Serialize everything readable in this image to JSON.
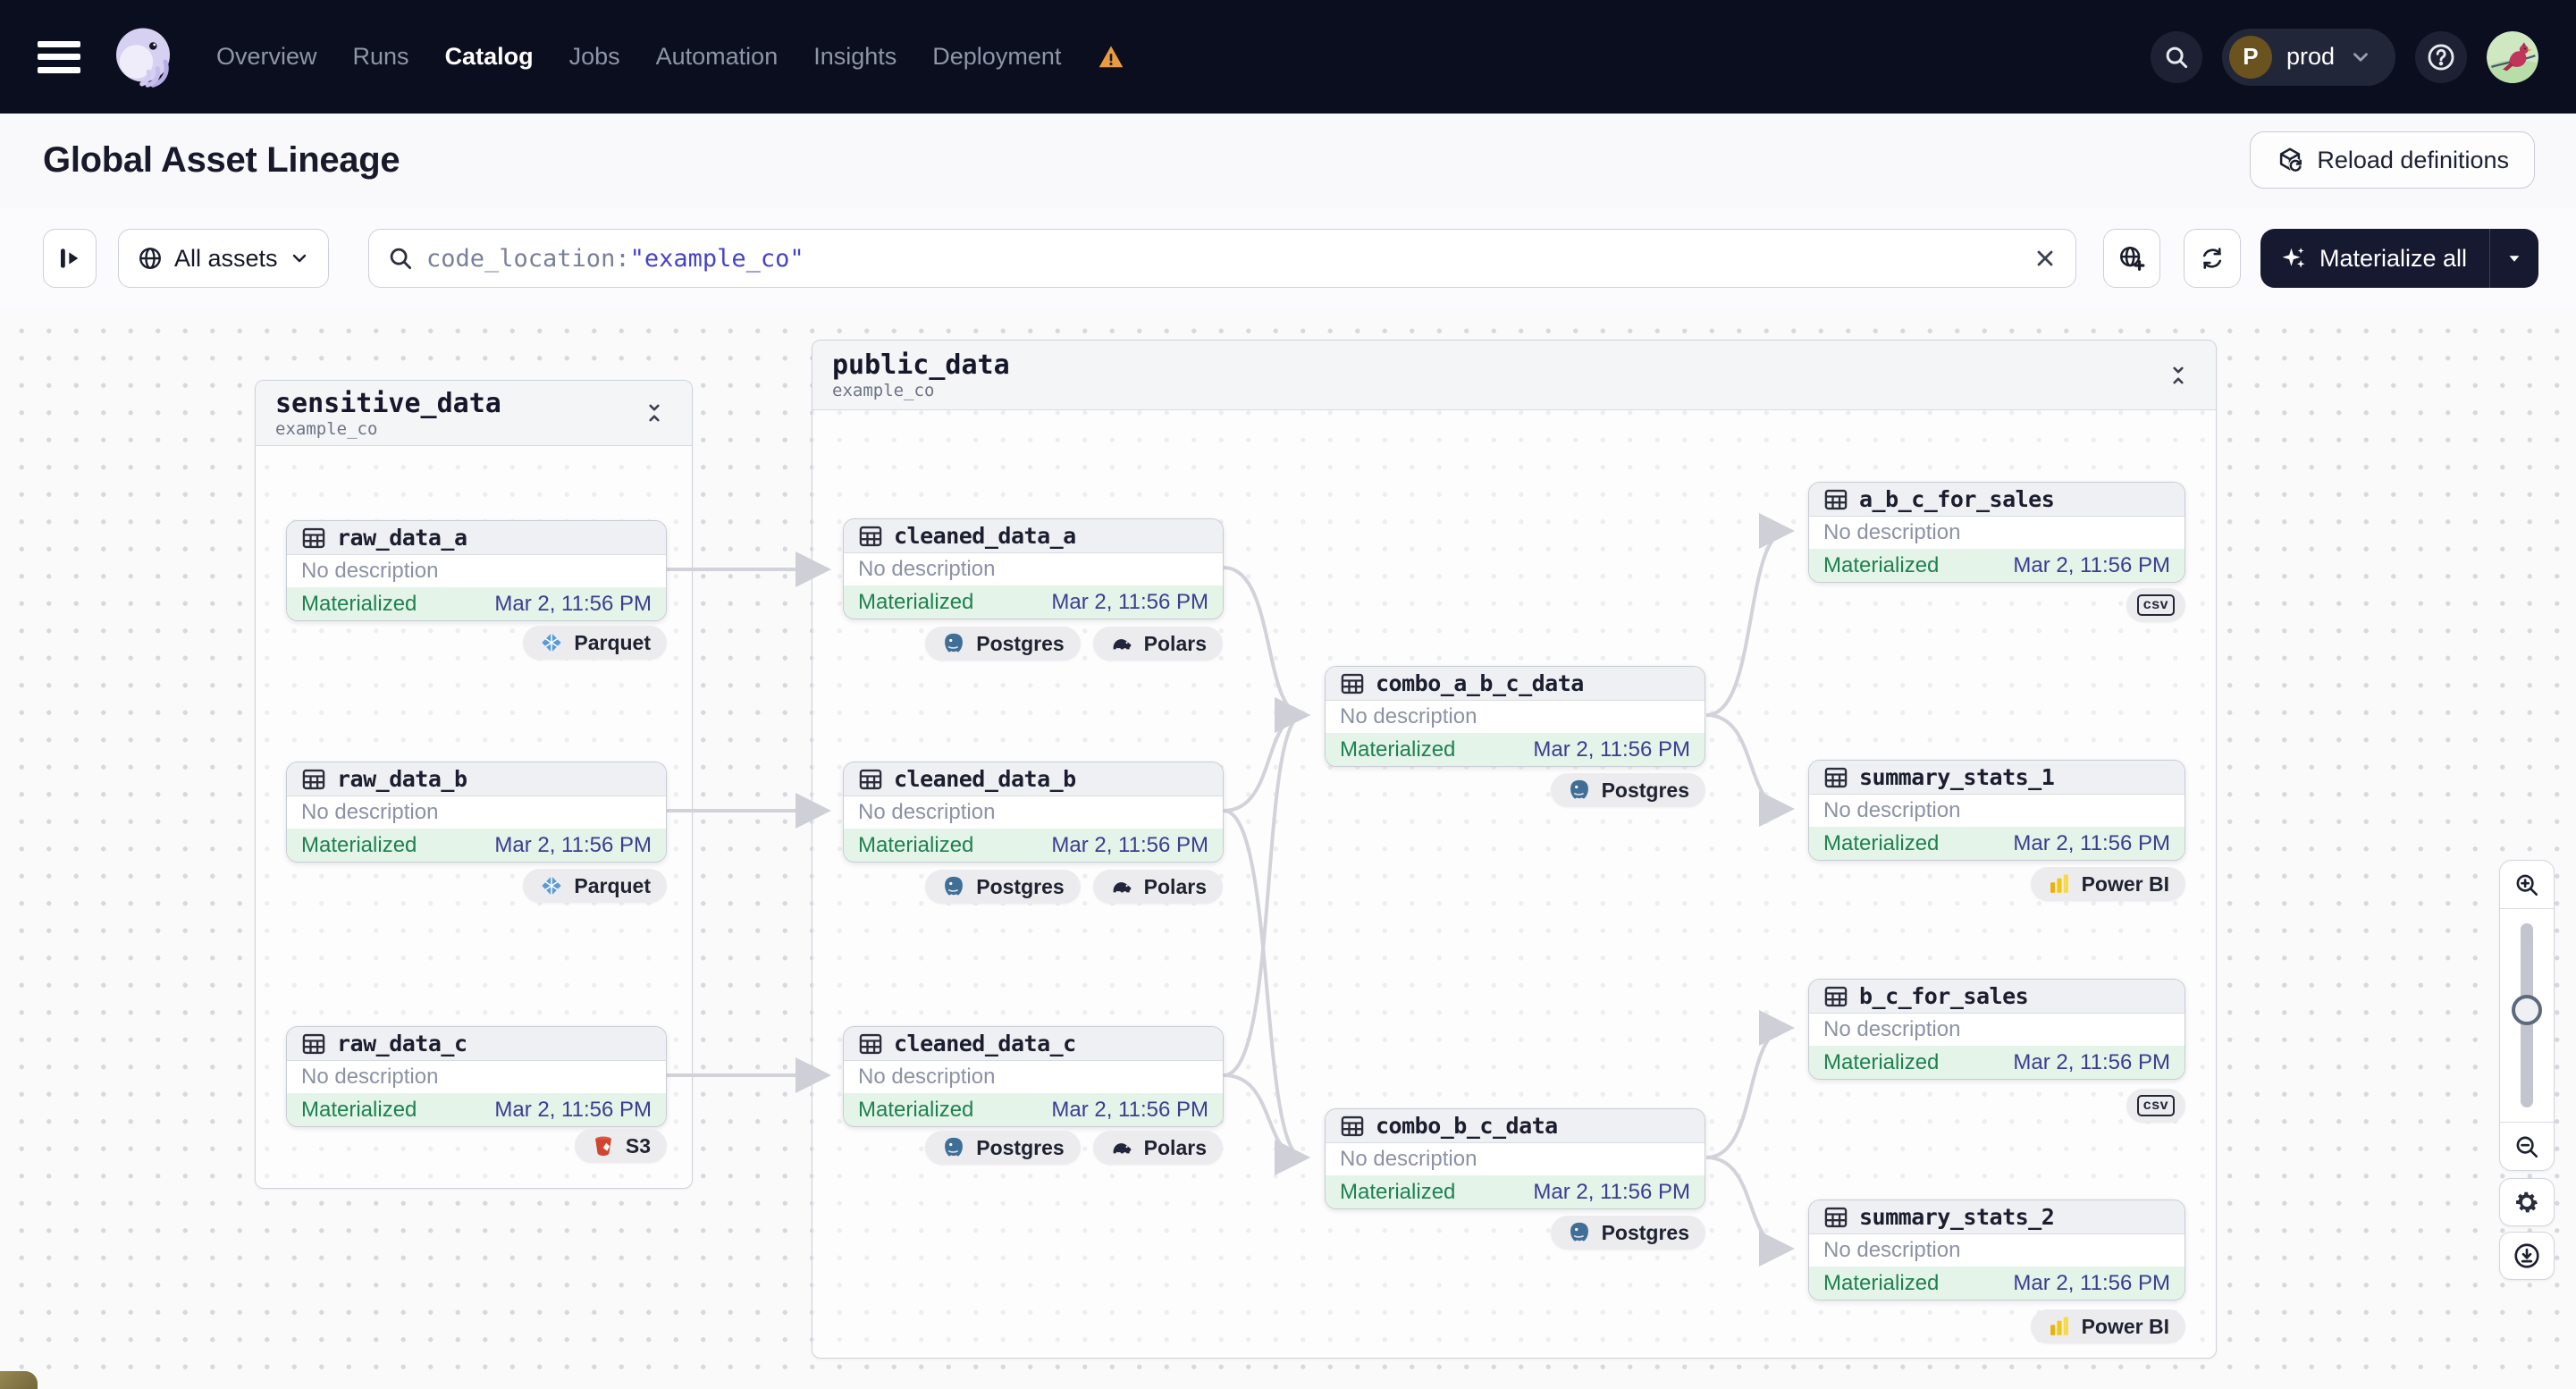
{
  "navbar": {
    "items": [
      {
        "label": "Overview"
      },
      {
        "label": "Runs"
      },
      {
        "label": "Catalog"
      },
      {
        "label": "Jobs"
      },
      {
        "label": "Automation"
      },
      {
        "label": "Insights"
      },
      {
        "label": "Deployment"
      }
    ],
    "environment": {
      "initial": "P",
      "name": "prod"
    }
  },
  "header": {
    "title": "Global Asset Lineage",
    "reload_button_label": "Reload definitions"
  },
  "toolbar": {
    "asset_filter_label": "All assets",
    "search_query_prefix": "code_location:",
    "search_query_value": "\"example_co\"",
    "materialize_button_label": "Materialize all"
  },
  "graph": {
    "groups": [
      {
        "name": "sensitive_data",
        "code_location": "example_co"
      },
      {
        "name": "public_data",
        "code_location": "example_co"
      }
    ],
    "nodes": [
      {
        "name": "raw_data_a",
        "description": "No description",
        "status": "Materialized",
        "timestamp": "Mar 2, 11:56 PM",
        "badges": [
          {
            "kind": "parquet",
            "label": "Parquet"
          }
        ]
      },
      {
        "name": "raw_data_b",
        "description": "No description",
        "status": "Materialized",
        "timestamp": "Mar 2, 11:56 PM",
        "badges": [
          {
            "kind": "parquet",
            "label": "Parquet"
          }
        ]
      },
      {
        "name": "raw_data_c",
        "description": "No description",
        "status": "Materialized",
        "timestamp": "Mar 2, 11:56 PM",
        "badges": [
          {
            "kind": "s3",
            "label": "S3"
          }
        ]
      },
      {
        "name": "cleaned_data_a",
        "description": "No description",
        "status": "Materialized",
        "timestamp": "Mar 2, 11:56 PM",
        "badges": [
          {
            "kind": "postgres",
            "label": "Postgres"
          },
          {
            "kind": "polars",
            "label": "Polars"
          }
        ]
      },
      {
        "name": "cleaned_data_b",
        "description": "No description",
        "status": "Materialized",
        "timestamp": "Mar 2, 11:56 PM",
        "badges": [
          {
            "kind": "postgres",
            "label": "Postgres"
          },
          {
            "kind": "polars",
            "label": "Polars"
          }
        ]
      },
      {
        "name": "cleaned_data_c",
        "description": "No description",
        "status": "Materialized",
        "timestamp": "Mar 2, 11:56 PM",
        "badges": [
          {
            "kind": "postgres",
            "label": "Postgres"
          },
          {
            "kind": "polars",
            "label": "Polars"
          }
        ]
      },
      {
        "name": "combo_a_b_c_data",
        "description": "No description",
        "status": "Materialized",
        "timestamp": "Mar 2, 11:56 PM",
        "badges": [
          {
            "kind": "postgres",
            "label": "Postgres"
          }
        ]
      },
      {
        "name": "combo_b_c_data",
        "description": "No description",
        "status": "Materialized",
        "timestamp": "Mar 2, 11:56 PM",
        "badges": [
          {
            "kind": "postgres",
            "label": "Postgres"
          }
        ]
      },
      {
        "name": "a_b_c_for_sales",
        "description": "No description",
        "status": "Materialized",
        "timestamp": "Mar 2, 11:56 PM",
        "badges": [
          {
            "kind": "csv",
            "label": "csv"
          }
        ]
      },
      {
        "name": "summary_stats_1",
        "description": "No description",
        "status": "Materialized",
        "timestamp": "Mar 2, 11:56 PM",
        "badges": [
          {
            "kind": "powerbi",
            "label": "Power BI"
          }
        ]
      },
      {
        "name": "b_c_for_sales",
        "description": "No description",
        "status": "Materialized",
        "timestamp": "Mar 2, 11:56 PM",
        "badges": [
          {
            "kind": "csv",
            "label": "csv"
          }
        ]
      },
      {
        "name": "summary_stats_2",
        "description": "No description",
        "status": "Materialized",
        "timestamp": "Mar 2, 11:56 PM",
        "badges": [
          {
            "kind": "powerbi",
            "label": "Power BI"
          }
        ]
      }
    ]
  }
}
